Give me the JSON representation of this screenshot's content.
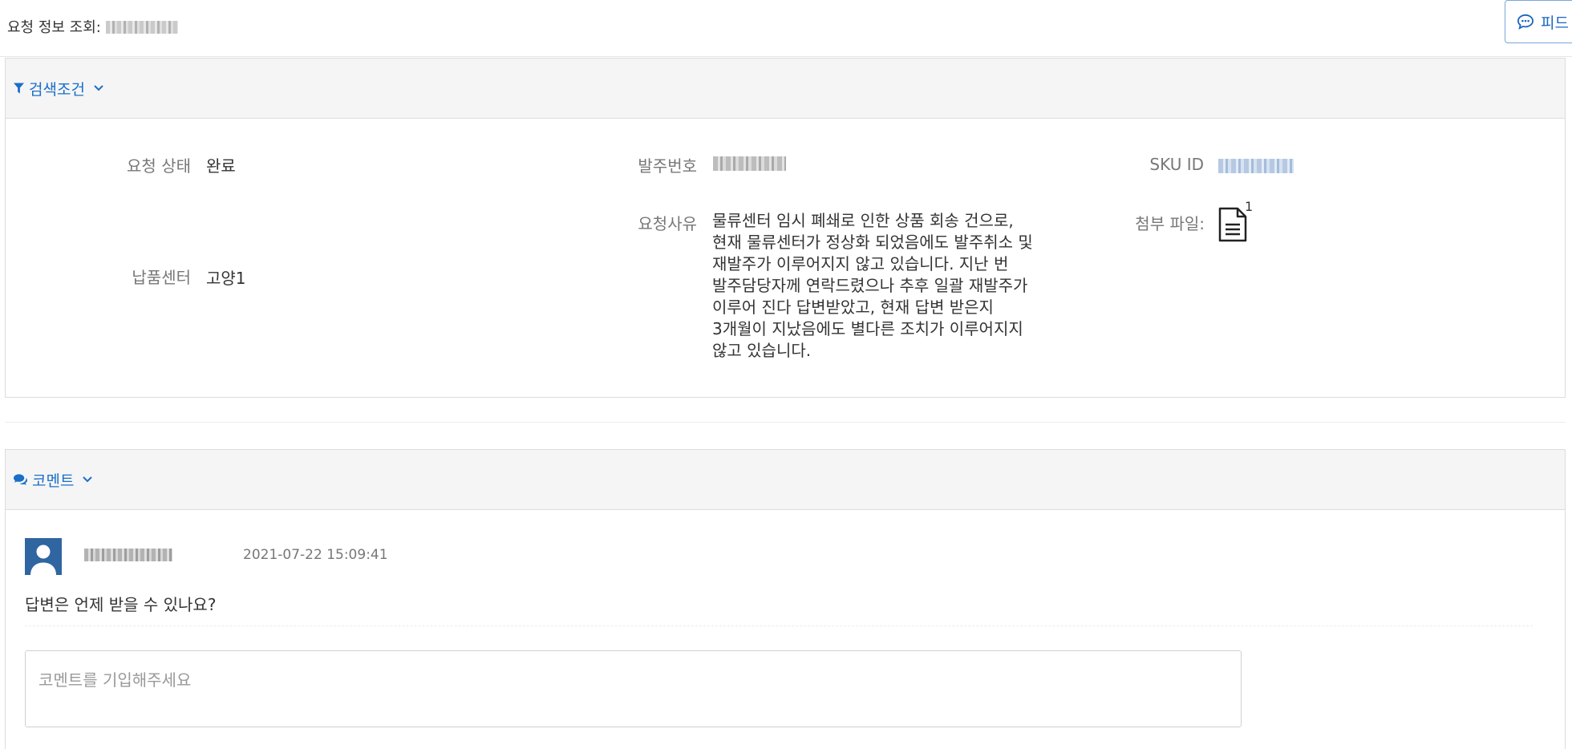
{
  "header": {
    "title": "요청 정보 조회:",
    "feedback_label": "피드",
    "feedback_icon": "comment-dots-icon"
  },
  "search_panel": {
    "title": "검색조건",
    "icon": "filter-icon",
    "fields": {
      "status_label": "요청 상태",
      "status_value": "완료",
      "po_label": "발주번호",
      "sku_label": "SKU ID",
      "center_label": "납품센터",
      "center_value": "고양1",
      "reason_label": "요청사유",
      "reason_value": "물류센터 임시 폐쇄로 인한 상품 회송 건으로, 현재 물류센터가 정상화 되었음에도 발주취소 및 재발주가 이루어지지 않고 있습니다. 지난 번 발주담당자께 연락드렸으나 추후 일괄 재발주가 이루어 진다 답변받았고, 현재 답변 받은지 3개월이 지났음에도 별다른 조치가 이루어지지 않고 있습니다.",
      "attachment_label": "첨부 파일:",
      "attachment_count": "1"
    }
  },
  "comment_panel": {
    "title": "코멘트",
    "icon": "comments-icon",
    "comments": [
      {
        "timestamp": "2021-07-22 15:09:41",
        "text": "답변은 언제 받을 수 있나요?"
      }
    ],
    "input_placeholder": "코멘트를 기입해주세요"
  },
  "colors": {
    "link_blue": "#1a6fc9",
    "avatar_bg": "#2f65a1",
    "panel_header_bg": "#f5f5f5"
  }
}
